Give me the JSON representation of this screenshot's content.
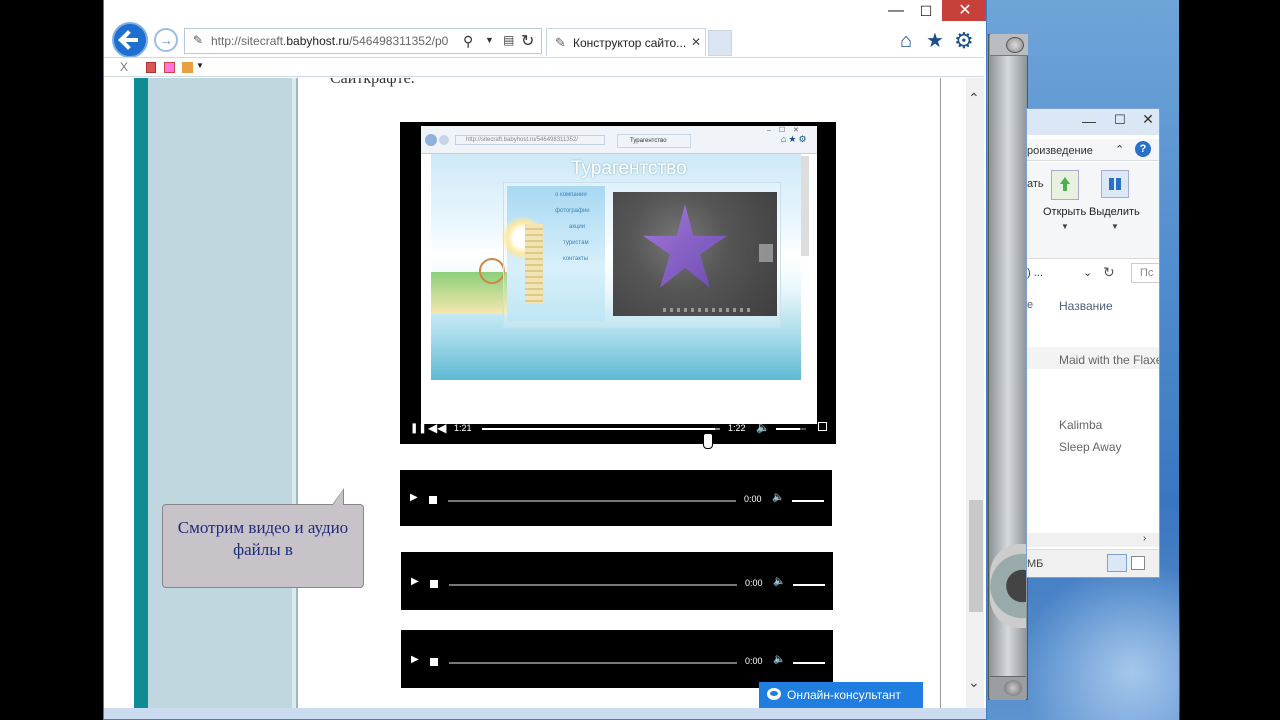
{
  "ie": {
    "url_prefix": "http://sitecraft.",
    "url_domain": "babyhost.ru",
    "url_suffix": "/546498311352/p0",
    "tab_title": "Конструктор сайто...",
    "min": "—",
    "max": "☐",
    "close": "✕",
    "tab_close": "✕",
    "cmd_close": "X"
  },
  "page": {
    "top_text": "Сайткрафте.",
    "callout": "Смотрим видео и аудио файлы в",
    "consultant": "Онлайн-консультант"
  },
  "video": {
    "current_time": "1:21",
    "duration": "1:22",
    "progress": 0.98,
    "volume": 0.8,
    "screenshot": {
      "url": "http://sitecraft.babyhost.ru/546498311352/",
      "tab": "Турагентство",
      "site_title": "Турагентство",
      "menu": [
        "о компании",
        "фотографии",
        "акции",
        "туристам",
        "контакты"
      ]
    }
  },
  "audio": [
    {
      "time": "0:00"
    },
    {
      "time": "0:00"
    },
    {
      "time": "0:00"
    }
  ],
  "explorer": {
    "tab_label": "роизведение",
    "ribbon_left": "ать",
    "open": "Открыть",
    "select": "Выделить",
    "address": ") ...",
    "search": "Пс",
    "col_left": "е",
    "col_name": "Название",
    "rows": [
      "Maid with the Flaxen Hair",
      "Kalimba",
      "Sleep Away"
    ],
    "status": "МБ",
    "help": "?"
  }
}
